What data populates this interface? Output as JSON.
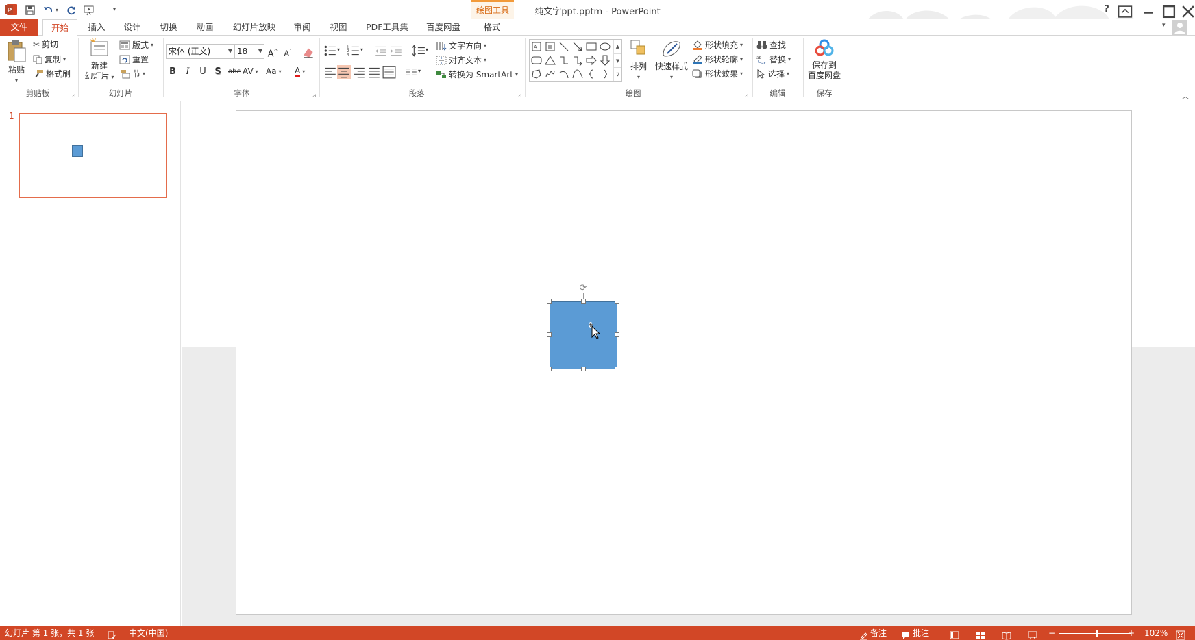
{
  "title_bar": {
    "document_title": "纯文字ppt.pptm - PowerPoint",
    "contextual_group": "绘图工具",
    "app_icon": "powerpoint-logo-icon",
    "qat_icons": [
      "save-icon",
      "undo-icon",
      "redo-icon",
      "start-from-beginning-icon",
      "customize-qat-icon"
    ],
    "window_icons": [
      "help-icon",
      "ribbon-display-options-icon",
      "minimize-icon",
      "restore-icon",
      "close-icon"
    ],
    "help_label": "?"
  },
  "tabs": [
    {
      "label": "文件"
    },
    {
      "label": "开始"
    },
    {
      "label": "插入"
    },
    {
      "label": "设计"
    },
    {
      "label": "切换"
    },
    {
      "label": "动画"
    },
    {
      "label": "幻灯片放映"
    },
    {
      "label": "审阅"
    },
    {
      "label": "视图"
    },
    {
      "label": "PDF工具集"
    },
    {
      "label": "百度网盘"
    },
    {
      "label": "格式"
    }
  ],
  "ribbon": {
    "clipboard": {
      "label": "剪贴板",
      "paste": "粘贴",
      "cut": "剪切",
      "copy": "复制",
      "format_painter": "格式刷"
    },
    "slides": {
      "label": "幻灯片",
      "new_slide_line1": "新建",
      "new_slide_line2": "幻灯片",
      "layout": "版式",
      "reset": "重置",
      "section": "节"
    },
    "font": {
      "label": "字体",
      "font_name": "宋体 (正文)",
      "font_size": "18",
      "bold": "B",
      "italic": "I",
      "underline": "U",
      "shadow": "S",
      "strikethrough": "abc",
      "spacing": "AV",
      "change_case": "Aa",
      "font_color": "A",
      "grow": "A",
      "shrink": "A"
    },
    "paragraph": {
      "label": "段落",
      "text_direction": "文字方向",
      "align_text": "对齐文本",
      "convert_smartart": "转换为 SmartArt"
    },
    "drawing": {
      "label": "绘图",
      "arrange": "排列",
      "quick_styles": "快速样式",
      "shape_fill": "形状填充",
      "shape_outline": "形状轮廓",
      "shape_effects": "形状效果"
    },
    "editing": {
      "label": "编辑",
      "find": "查找",
      "replace": "替换",
      "select": "选择"
    },
    "save": {
      "label": "保存",
      "save_to_line1": "保存到",
      "save_to_line2": "百度网盘"
    }
  },
  "thumbnails": [
    {
      "number": "1"
    }
  ],
  "status_bar": {
    "slide_info": "幻灯片 第 1 张，共 1 张",
    "language": "中文(中国)",
    "notes": "备注",
    "comments": "批注",
    "zoom_level": "102%",
    "zoom_fraction": 0.52,
    "minus": "−",
    "plus": "+"
  },
  "colors": {
    "accent": "#d24726",
    "shape_fill": "#5b9bd5",
    "shape_border": "#41719c",
    "context_orange": "#f29a3a"
  }
}
